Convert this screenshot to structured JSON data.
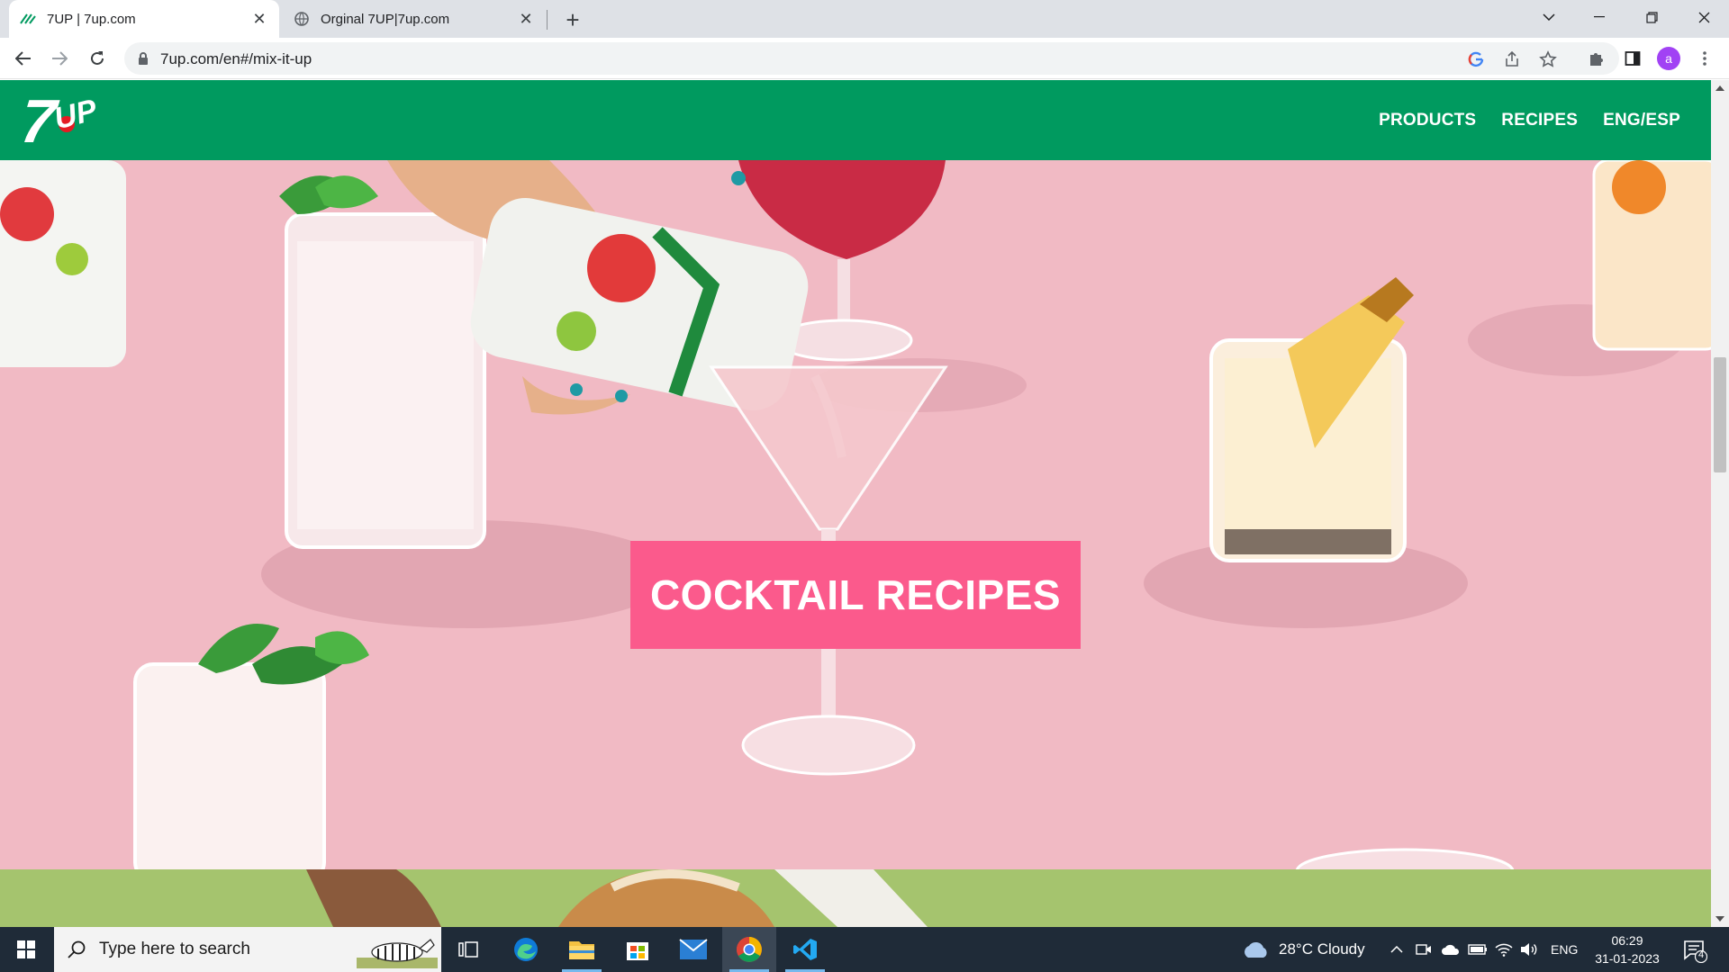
{
  "browser": {
    "tabs": [
      {
        "title": "7UP | 7up.com",
        "active": true
      },
      {
        "title": "Orginal 7UP|7up.com",
        "active": false
      }
    ],
    "url": "7up.com/en#/mix-it-up",
    "profile_initial": "a"
  },
  "site": {
    "logo_text": "7UP",
    "nav": [
      "PRODUCTS",
      "RECIPES",
      "ENG/ESP"
    ],
    "hero_button": "COCKTAIL RECIPES",
    "colors": {
      "header": "#009a5f",
      "hero_bg": "#f1bac4",
      "button": "#fb5a8c",
      "next_section": "#a5c46e"
    }
  },
  "taskbar": {
    "search_placeholder": "Type here to search",
    "weather": "28°C  Cloudy",
    "language": "ENG",
    "time": "06:29",
    "date": "31-01-2023",
    "notifications": "4"
  }
}
